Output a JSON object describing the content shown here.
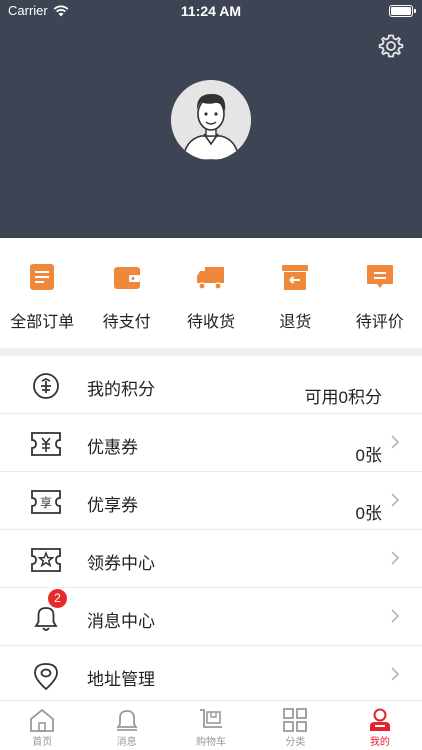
{
  "status_bar": {
    "carrier": "Carrier",
    "time": "11:24 AM"
  },
  "header": {
    "settings_icon": "gear-icon",
    "avatar": "user-avatar-portrait"
  },
  "orders": [
    {
      "label": "全部订单",
      "icon": "order-list-icon"
    },
    {
      "label": "待支付",
      "icon": "wallet-icon"
    },
    {
      "label": "待收货",
      "icon": "truck-icon"
    },
    {
      "label": "退货",
      "icon": "return-box-icon"
    },
    {
      "label": "待评价",
      "icon": "comment-icon"
    }
  ],
  "menu": [
    {
      "label": "我的积分",
      "value": "可用0积分",
      "icon": "points-coin-icon",
      "has_arrow": false
    },
    {
      "label": "优惠券",
      "value": "0张",
      "icon": "coupon-icon",
      "has_arrow": true
    },
    {
      "label": "优享券",
      "value": "0张",
      "icon": "share-coupon-icon",
      "has_arrow": true
    },
    {
      "label": "领券中心",
      "value": "",
      "icon": "coupon-center-icon",
      "has_arrow": true
    },
    {
      "label": "消息中心",
      "value": "",
      "icon": "bell-icon",
      "badge": "2",
      "has_arrow": true
    },
    {
      "label": "地址管理",
      "value": "",
      "icon": "location-pin-icon",
      "has_arrow": true
    }
  ],
  "tabbar": [
    {
      "label": "首页",
      "icon": "home-icon",
      "active": false
    },
    {
      "label": "消息",
      "icon": "bell-icon",
      "active": false
    },
    {
      "label": "购物车",
      "icon": "cart-icon",
      "active": false
    },
    {
      "label": "分类",
      "icon": "grid-icon",
      "active": false
    },
    {
      "label": "我的",
      "icon": "profile-icon",
      "active": true
    }
  ],
  "colors": {
    "header_bg": "#3d4453",
    "accent_orange": "#f0883b",
    "badge_red": "#e42a2a",
    "tab_active": "#e4222b",
    "tab_inactive": "#9a9a9a"
  }
}
